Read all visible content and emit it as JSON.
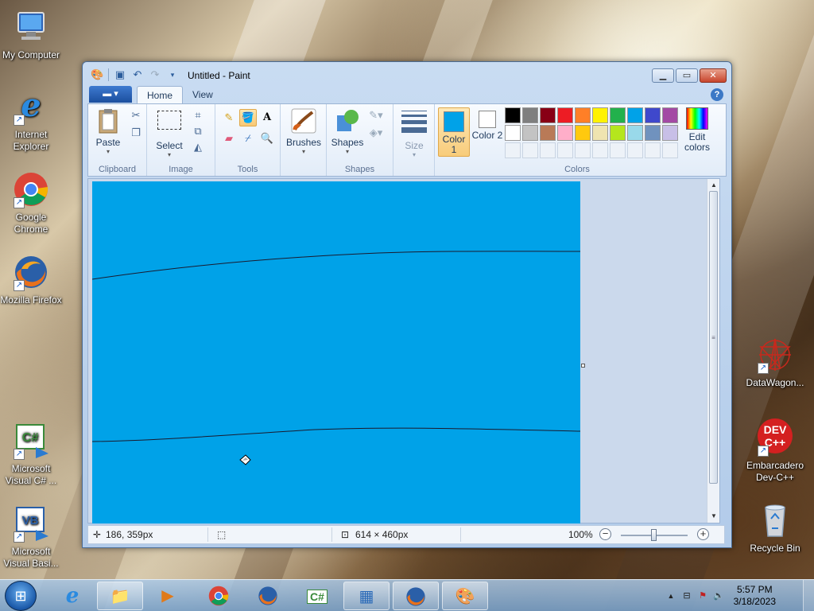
{
  "desktop": {
    "icons_left": [
      {
        "label": "My Computer",
        "icon": "computer-icon"
      },
      {
        "label": "Internet Explorer",
        "icon": "internet-explorer-icon"
      },
      {
        "label": "Google Chrome",
        "icon": "chrome-icon"
      },
      {
        "label": "Mozilla Firefox",
        "icon": "firefox-icon"
      },
      {
        "label": "Microsoft Visual C# ...",
        "icon": "visual-csharp-icon"
      },
      {
        "label": "Microsoft Visual Basi...",
        "icon": "visual-basic-icon"
      }
    ],
    "icons_right": [
      {
        "label": "DataWagon...",
        "icon": "datawagon-icon"
      },
      {
        "label": "Embarcadero Dev-C++",
        "icon": "devcpp-icon"
      },
      {
        "label": "Recycle Bin",
        "icon": "recycle-bin-icon"
      }
    ],
    "devcpp_badge": "DEV\nC++",
    "vcs_badge": "C#",
    "vb_badge": "VB"
  },
  "paint": {
    "title": "Untitled - Paint",
    "tabs": {
      "file": "▾",
      "home": "Home",
      "view": "View"
    },
    "groups": {
      "clipboard": "Clipboard",
      "image": "Image",
      "tools": "Tools",
      "shapes": "Shapes",
      "colors": "Colors"
    },
    "buttons": {
      "paste": "Paste",
      "select": "Select",
      "brushes": "Brushes",
      "shapes": "Shapes",
      "size": "Size",
      "color1": "Color 1",
      "color2": "Color 2",
      "edit_colors": "Edit colors"
    },
    "color1_value": "#00a2e8",
    "color2_value": "#ffffff",
    "palette_row1": [
      "#000000",
      "#7f7f7f",
      "#880015",
      "#ed1c24",
      "#ff7f27",
      "#fff200",
      "#22b14c",
      "#00a2e8",
      "#3f48cc",
      "#a349a4"
    ],
    "palette_row2": [
      "#ffffff",
      "#c3c3c3",
      "#b97a57",
      "#ffaec9",
      "#ffc90e",
      "#efe4b0",
      "#b5e61d",
      "#99d9ea",
      "#7092be",
      "#c8bfe7"
    ],
    "canvas_fill": "#00a2e8",
    "status": {
      "cursor_pos": "186, 359px",
      "image_size": "614 × 460px",
      "zoom": "100%"
    }
  },
  "taskbar": {
    "start_icon": "windows-start-icon",
    "buttons": [
      {
        "icon": "internet-explorer-icon",
        "open": false
      },
      {
        "icon": "file-explorer-icon",
        "open": true
      },
      {
        "icon": "media-player-icon",
        "open": false
      },
      {
        "icon": "chrome-icon",
        "open": false
      },
      {
        "icon": "firefox-icon",
        "open": false
      },
      {
        "icon": "visual-csharp-icon",
        "open": false
      },
      {
        "icon": "control-panel-icon",
        "open": true
      },
      {
        "icon": "firefox-icon",
        "open": true
      },
      {
        "icon": "paint-icon",
        "open": true
      }
    ],
    "clock_time": "5:57 PM",
    "clock_date": "3/18/2023"
  }
}
